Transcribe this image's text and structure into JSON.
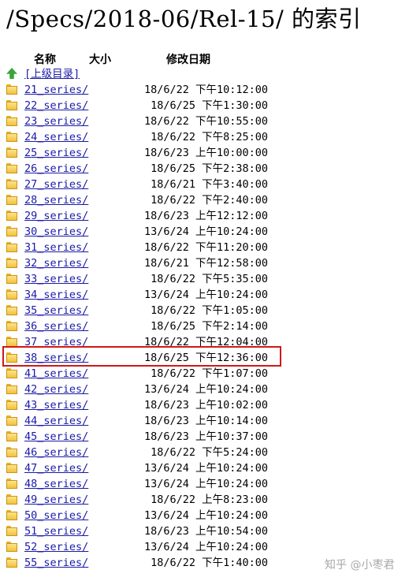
{
  "page_title": "/Specs/2018-06/Rel-15/ 的索引",
  "columns": {
    "name": "名称",
    "size": "大小",
    "date": "修改日期"
  },
  "parent_link": "[上级目录]",
  "entries": [
    {
      "name": "21_series/",
      "date": "18/6/22 下午10:12:00"
    },
    {
      "name": "22_series/",
      "date": "18/6/25 下午1:30:00"
    },
    {
      "name": "23_series/",
      "date": "18/6/22 下午10:55:00"
    },
    {
      "name": "24_series/",
      "date": "18/6/22 下午8:25:00"
    },
    {
      "name": "25_series/",
      "date": "18/6/23 上午10:00:00"
    },
    {
      "name": "26_series/",
      "date": "18/6/25 下午2:38:00"
    },
    {
      "name": "27_series/",
      "date": "18/6/21 下午3:40:00"
    },
    {
      "name": "28_series/",
      "date": "18/6/22 下午2:40:00"
    },
    {
      "name": "29_series/",
      "date": "18/6/23 上午12:12:00"
    },
    {
      "name": "30_series/",
      "date": "13/6/24 上午10:24:00"
    },
    {
      "name": "31_series/",
      "date": "18/6/22 下午11:20:00"
    },
    {
      "name": "32_series/",
      "date": "18/6/21 下午12:58:00"
    },
    {
      "name": "33_series/",
      "date": "18/6/22 下午5:35:00"
    },
    {
      "name": "34_series/",
      "date": "13/6/24 上午10:24:00"
    },
    {
      "name": "35_series/",
      "date": "18/6/22 下午1:05:00"
    },
    {
      "name": "36_series/",
      "date": "18/6/25 下午2:14:00"
    },
    {
      "name": "37_series/",
      "date": "18/6/22 下午12:04:00"
    },
    {
      "name": "38_series/",
      "date": "18/6/25 下午12:36:00",
      "highlighted": true
    },
    {
      "name": "41_series/",
      "date": "18/6/22 下午1:07:00"
    },
    {
      "name": "42_series/",
      "date": "13/6/24 上午10:24:00"
    },
    {
      "name": "43_series/",
      "date": "18/6/23 上午10:02:00"
    },
    {
      "name": "44_series/",
      "date": "18/6/23 上午10:14:00"
    },
    {
      "name": "45_series/",
      "date": "18/6/23 上午10:37:00"
    },
    {
      "name": "46_series/",
      "date": "18/6/22 下午5:24:00"
    },
    {
      "name": "47_series/",
      "date": "13/6/24 上午10:24:00"
    },
    {
      "name": "48_series/",
      "date": "13/6/24 上午10:24:00"
    },
    {
      "name": "49_series/",
      "date": "18/6/22 上午8:23:00"
    },
    {
      "name": "50_series/",
      "date": "13/6/24 上午10:24:00"
    },
    {
      "name": "51_series/",
      "date": "18/6/23 上午10:54:00"
    },
    {
      "name": "52_series/",
      "date": "13/6/24 上午10:24:00"
    },
    {
      "name": "55_series/",
      "date": "18/6/22 下午1:40:00"
    }
  ],
  "watermark": "知乎 @小枣君",
  "colors": {
    "link": "#1a1aa8",
    "highlight_border": "#d01818",
    "folder": "#f2c23a"
  }
}
